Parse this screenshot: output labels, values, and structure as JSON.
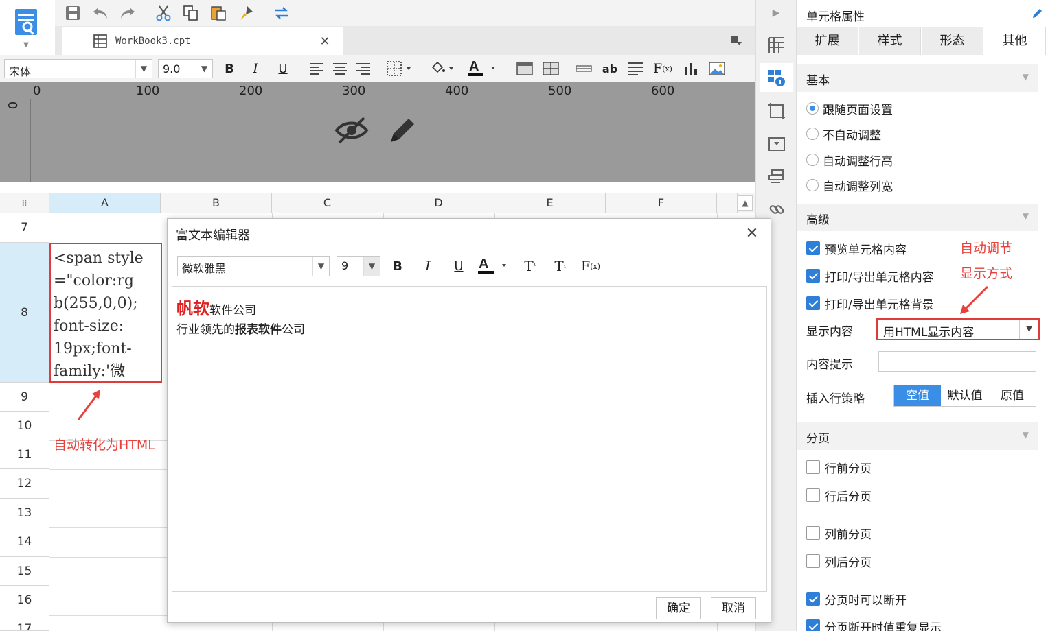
{
  "editor": {
    "tab_title": "WorkBook3.cpt",
    "font_name": "宋体",
    "font_size": "9.0",
    "ruler_marks": [
      "0",
      "100",
      "200",
      "300",
      "400",
      "500",
      "600"
    ],
    "vruler_mark": "0",
    "columns": [
      "A",
      "B",
      "C",
      "D",
      "E",
      "F"
    ],
    "rows": [
      "7",
      "8",
      "9",
      "10",
      "11",
      "12",
      "13",
      "14",
      "15",
      "16",
      "17"
    ],
    "cell_a8_lines": [
      "<span style",
      "=\"color:rg",
      "b(255,0,0);",
      "font-size:",
      "19px;font-",
      "family:'微"
    ],
    "annotation_left": "自动转化为HTML"
  },
  "dialog": {
    "title": "富文本编辑器",
    "font_name": "微软雅黑",
    "font_size": "9",
    "content_bold_red": "帆软",
    "content_rest": "软件公司",
    "line2_prefix": "行业领先的",
    "line2_bold": "报表软件",
    "line2_suffix": "公司",
    "ok_label": "确定",
    "cancel_label": "取消"
  },
  "panel": {
    "title": "单元格属性",
    "tabs": [
      "扩展",
      "样式",
      "形态",
      "其他"
    ],
    "section_basic": "基本",
    "radios": [
      "跟随页面设置",
      "不自动调整",
      "自动调整行高",
      "自动调整列宽"
    ],
    "section_advanced": "高级",
    "adv_checks": [
      "预览单元格内容",
      "打印/导出单元格内容",
      "打印/导出单元格背景"
    ],
    "display_label": "显示内容",
    "display_value": "用HTML显示内容",
    "tooltip_label": "内容提示",
    "insert_label": "插入行策略",
    "insert_options": [
      "空值",
      "默认值",
      "原值"
    ],
    "section_paging": "分页",
    "page_checks": [
      "行前分页",
      "行后分页",
      "列前分页",
      "列后分页",
      "分页时可以断开",
      "分页断开时值重复显示"
    ],
    "annotation_right_1": "自动调节",
    "annotation_right_2": "显示方式"
  },
  "colors": {
    "accent": "#3a8ee6",
    "annotation": "#e8403c",
    "selected_header": "#d6ecf8"
  }
}
